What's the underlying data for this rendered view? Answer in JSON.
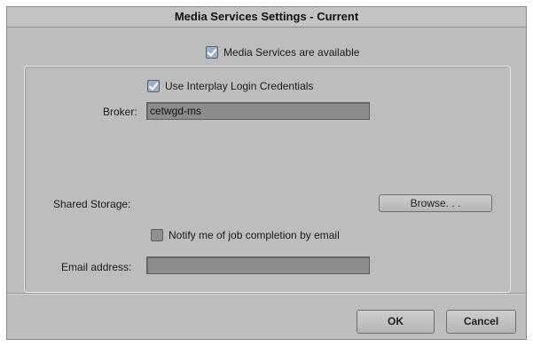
{
  "dialog": {
    "title": "Media Services Settings - Current"
  },
  "media_services": {
    "label": "Media Services are available",
    "checked": true
  },
  "interplay_login": {
    "label": "Use Interplay Login Credentials",
    "checked": true
  },
  "broker": {
    "label": "Broker:",
    "value": "cetwgd-ms"
  },
  "shared_storage": {
    "label": "Shared Storage:",
    "browse_label": "Browse. . ."
  },
  "notify": {
    "label": "Notify me of job completion by email",
    "checked": false
  },
  "email": {
    "label": "Email address:",
    "value": ""
  },
  "footer": {
    "ok_label": "OK",
    "cancel_label": "Cancel"
  },
  "icons": {
    "checkbox": "checkbox-icon"
  }
}
